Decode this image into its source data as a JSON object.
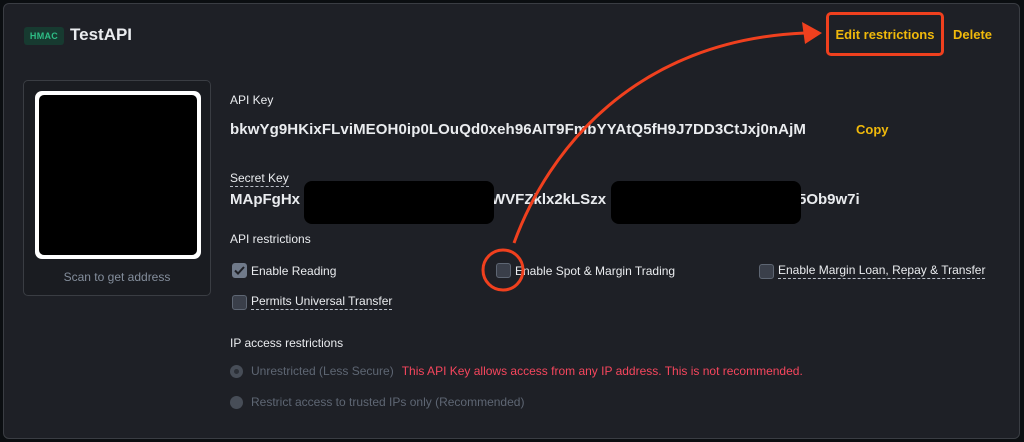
{
  "header": {
    "badge": "HMAC",
    "api_name": "TestAPI",
    "edit_label": "Edit restrictions",
    "delete_label": "Delete"
  },
  "qr": {
    "caption": "Scan to get address"
  },
  "api_key": {
    "label": "API Key",
    "value": "bkwYg9HKixFLviMEOH0ip0LOuQd0xeh96AIT9FmbYYAtQ5fH9J7DD3CtJxj0nAjM",
    "copy_label": "Copy"
  },
  "secret_key": {
    "label": "Secret Key",
    "part1": "MApFgHx",
    "part2": "WVFZklx2kLSzx",
    "part3": "5Ob9w7i"
  },
  "restrictions": {
    "label": "API restrictions",
    "enable_reading": {
      "label": "Enable Reading",
      "checked": true
    },
    "spot_margin": {
      "label": "Enable Spot & Margin Trading",
      "checked": false
    },
    "margin_loan": {
      "label": "Enable Margin Loan, Repay & Transfer",
      "checked": false
    },
    "universal_transfer": {
      "label": "Permits Universal Transfer",
      "checked": false
    }
  },
  "ip_access": {
    "label": "IP access restrictions",
    "unrestricted_label": "Unrestricted (Less Secure)",
    "warning": "This API Key allows access from any IP address. This is not recommended.",
    "restricted_label": "Restrict access to trusted IPs only (Recommended)",
    "selected": "unrestricted"
  },
  "colors": {
    "accent": "#f0b90b",
    "annotation": "#f0401e",
    "warning": "#f6465d",
    "badge": "#2ebd85"
  }
}
